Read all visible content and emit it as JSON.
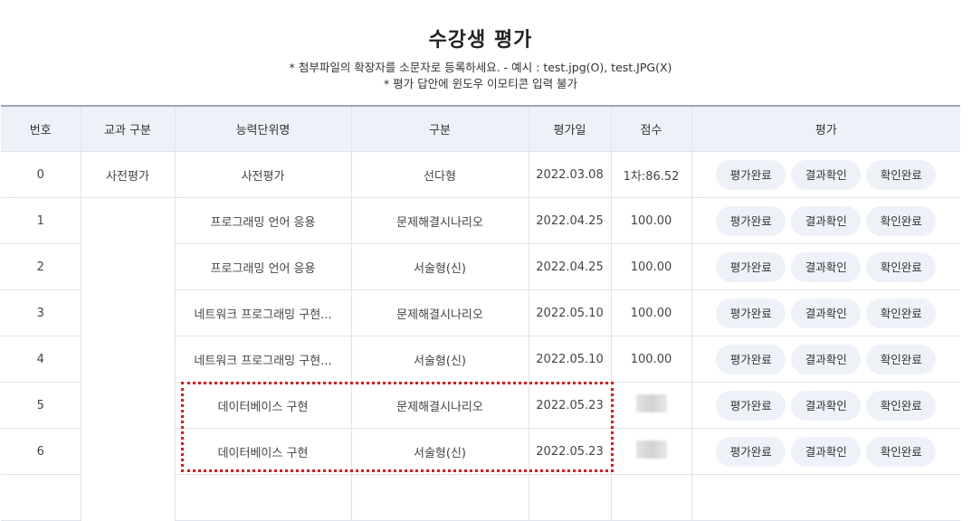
{
  "page": {
    "title": "수강생 평가",
    "notes": [
      "* 첨부파일의 확장자를 소문자로 등록하세요. - 예시 : test.jpg(O), test.JPG(X)",
      "* 평가 답안에 윈도우 이모티콘 입력 불가"
    ]
  },
  "table": {
    "headers": [
      "번호",
      "교과 구분",
      "능력단위명",
      "구분",
      "평가일",
      "점수",
      "평가"
    ],
    "rows": [
      {
        "no": "0",
        "category": "사전평가",
        "unit": "사전평가",
        "type": "선다형",
        "date": "2022.03.08",
        "score": "1차:86.52"
      },
      {
        "no": "1",
        "category": "",
        "unit": "프로그래밍 언어 응용",
        "type": "문제해결시나리오",
        "date": "2022.04.25",
        "score": "100.00"
      },
      {
        "no": "2",
        "category": "",
        "unit": "프로그래밍 언어 응용",
        "type": "서술형(신)",
        "date": "2022.04.25",
        "score": "100.00"
      },
      {
        "no": "3",
        "category": "",
        "unit": "네트워크 프로그래밍 구현...",
        "type": "문제해결시나리오",
        "date": "2022.05.10",
        "score": "100.00"
      },
      {
        "no": "4",
        "category": "",
        "unit": "네트워크 프로그래밍 구현...",
        "type": "서술형(신)",
        "date": "2022.05.10",
        "score": "100.00"
      },
      {
        "no": "5",
        "category": "",
        "unit": "데이터베이스 구현",
        "type": "문제해결시나리오",
        "date": "2022.05.23",
        "score": ""
      },
      {
        "no": "6",
        "category": "",
        "unit": "데이터베이스 구현",
        "type": "서술형(신)",
        "date": "2022.05.23",
        "score": ""
      }
    ],
    "buttons": {
      "eval_done": "평가완료",
      "result_check": "결과확인",
      "confirm_done": "확인완료"
    }
  },
  "colors": {
    "header_bg": "#eef2f8",
    "button_bg": "#eef2f8",
    "highlight_border": "#e01717"
  }
}
